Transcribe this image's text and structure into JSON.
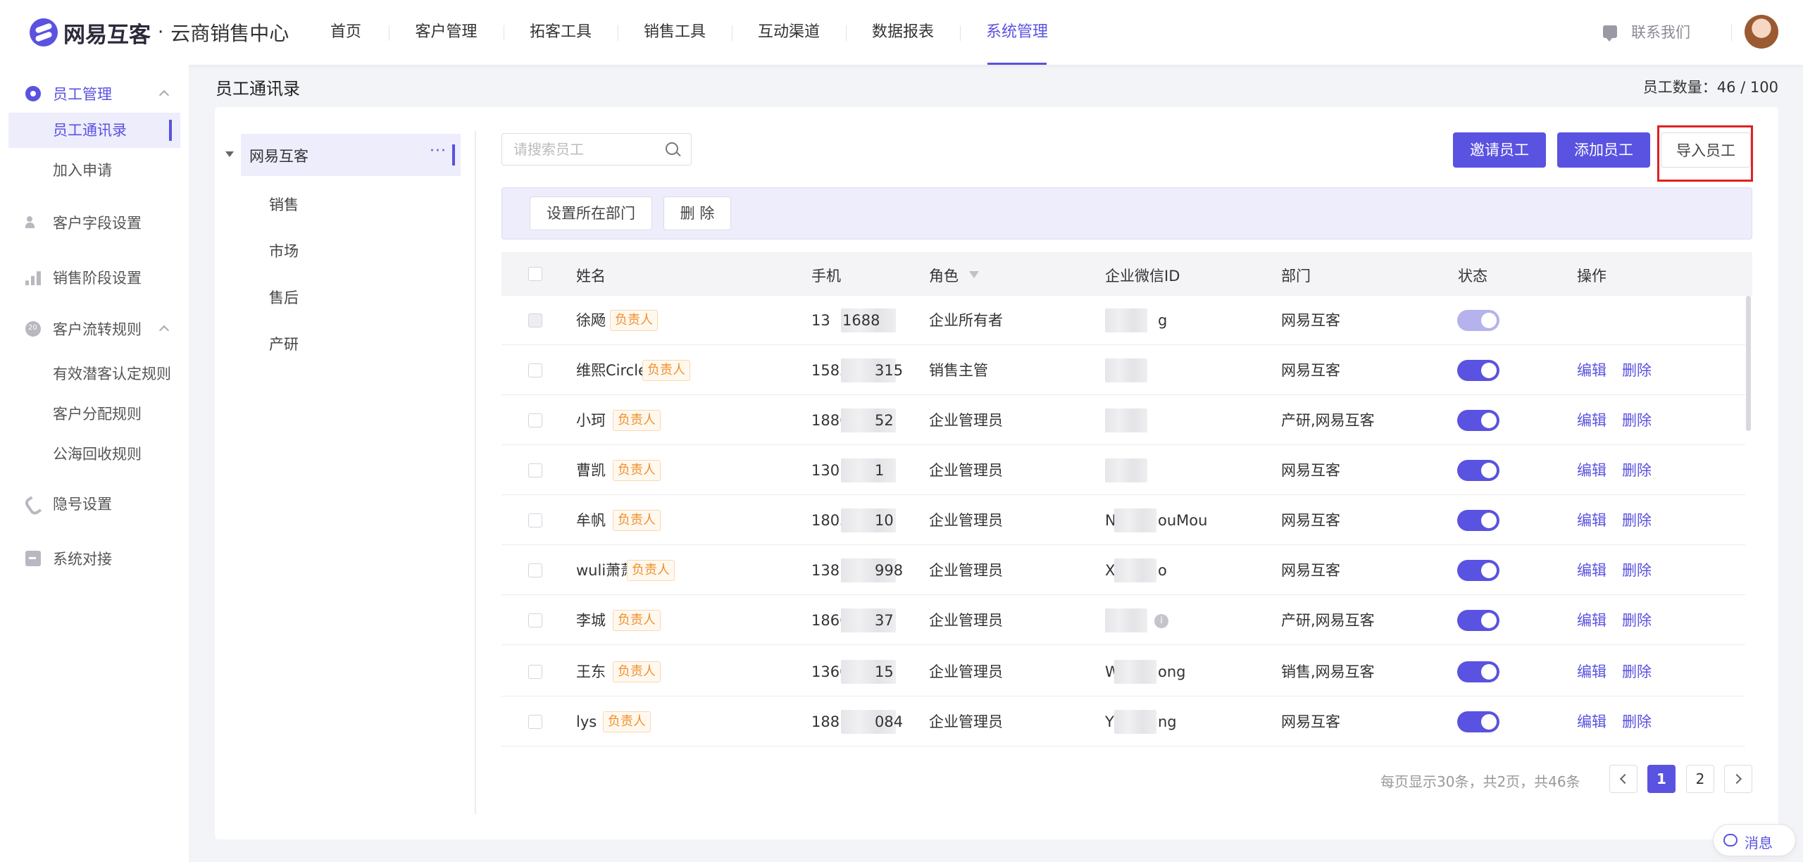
{
  "brand": {
    "name": "网易互客",
    "separator": "·",
    "product": "云商销售中心"
  },
  "nav": [
    {
      "label": "首页"
    },
    {
      "label": "客户管理"
    },
    {
      "label": "拓客工具"
    },
    {
      "label": "销售工具"
    },
    {
      "label": "互动渠道"
    },
    {
      "label": "数据报表"
    },
    {
      "label": "系统管理",
      "active": true
    }
  ],
  "header": {
    "contact_label": "联系我们"
  },
  "sidebar": {
    "groups": [
      {
        "label": "员工管理",
        "icon": "gear-icon",
        "active": true,
        "expanded": true,
        "items": [
          {
            "label": "员工通讯录",
            "active": true
          },
          {
            "label": "加入申请"
          }
        ]
      },
      {
        "label": "客户字段设置",
        "icon": "user-icon"
      },
      {
        "label": "销售阶段设置",
        "icon": "bars-icon"
      },
      {
        "label": "客户流转规则",
        "icon": "flow-icon",
        "expanded": true,
        "items": [
          {
            "label": "有效潜客认定规则"
          },
          {
            "label": "客户分配规则"
          },
          {
            "label": "公海回收规则"
          }
        ]
      },
      {
        "label": "隐号设置",
        "icon": "phone-icon"
      },
      {
        "label": "系统对接",
        "icon": "link-icon"
      }
    ]
  },
  "page": {
    "title": "员工通讯录",
    "count_label": "员工数量：46 / 100"
  },
  "tree": {
    "root": {
      "label": "网易互客",
      "more": "···"
    },
    "children": [
      {
        "label": "销售"
      },
      {
        "label": "市场"
      },
      {
        "label": "售后"
      },
      {
        "label": "产研"
      }
    ]
  },
  "search": {
    "placeholder": "请搜索员工",
    "value": ""
  },
  "actions": {
    "invite": "邀请员工",
    "add": "添加员工",
    "import": "导入员工"
  },
  "toolbar": {
    "set_dept": "设置所在部门",
    "delete": "删 除"
  },
  "table": {
    "columns": {
      "name": "姓名",
      "phone": "手机",
      "role": "角色",
      "wechat": "企业微信ID",
      "dept": "部门",
      "status": "状态",
      "ops": "操作"
    },
    "owner_tag": "负责人",
    "edit_label": "编辑",
    "delete_label": "删除",
    "rows": [
      {
        "name": "徐飏",
        "phone_a": "13",
        "phone_b": "1688",
        "role": "企业所有者",
        "wechat_a": "",
        "wechat_b": "g",
        "dept": "网易互客",
        "status_on": true,
        "owner": true,
        "editable": false
      },
      {
        "name": "维熙Circle",
        "phone_a": "1585",
        "phone_b": "315",
        "role": "销售主管",
        "wechat_a": "",
        "wechat_b": "",
        "dept": "网易互客",
        "status_on": true,
        "editable": true
      },
      {
        "name": "小珂",
        "phone_a": "1886",
        "phone_b": "52",
        "role": "企业管理员",
        "wechat_a": "",
        "wechat_b": "",
        "dept": "产研,网易互客",
        "status_on": true,
        "editable": true
      },
      {
        "name": "曹凯",
        "phone_a": "1301",
        "phone_b": "1",
        "role": "企业管理员",
        "wechat_a": "",
        "wechat_b": "",
        "dept": "网易互客",
        "status_on": true,
        "editable": true
      },
      {
        "name": "牟帆",
        "phone_a": "1805",
        "phone_b": "10",
        "role": "企业管理员",
        "wechat_a": "N",
        "wechat_b": "ouMou",
        "dept": "网易互客",
        "status_on": true,
        "editable": true
      },
      {
        "name": "wuli萧萧",
        "phone_a": "138",
        "phone_b": "998",
        "role": "企业管理员",
        "wechat_a": "X",
        "wechat_b": "o",
        "dept": "网易互客",
        "status_on": true,
        "editable": true
      },
      {
        "name": "李城",
        "phone_a": "1866",
        "phone_b": "37",
        "role": "企业管理员",
        "wechat_a": "",
        "wechat_b": "",
        "dept": "产研,网易互客",
        "status_on": true,
        "editable": true,
        "info": true
      },
      {
        "name": "王东",
        "phone_a": "1360",
        "phone_b": "15",
        "role": "企业管理员",
        "wechat_a": "W",
        "wechat_b": "ong",
        "dept": "销售,网易互客",
        "status_on": true,
        "editable": true
      },
      {
        "name": "lys",
        "phone_a": "188",
        "phone_b": "084",
        "role": "企业管理员",
        "wechat_a": "Y",
        "wechat_b": "ng",
        "dept": "网易互客",
        "status_on": true,
        "editable": true
      }
    ]
  },
  "pagination": {
    "info": "每页显示30条，共2页，共46条",
    "pages": [
      "1",
      "2"
    ],
    "current": "1"
  },
  "message_button": {
    "label": "消息"
  },
  "colors": {
    "accent": "#5a52e0",
    "tag_text": "#f0902a",
    "highlight": "#e02020"
  }
}
